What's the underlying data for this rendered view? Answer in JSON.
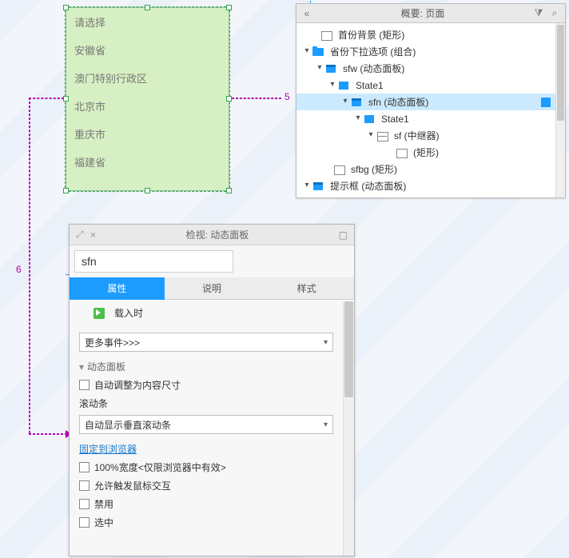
{
  "listbox": {
    "items": [
      "请选择",
      "安徽省",
      "澳门特别行政区",
      "北京市",
      "重庆市",
      "福建省"
    ]
  },
  "annotations": {
    "num5": "5",
    "num6": "6"
  },
  "outline": {
    "title": "概要: 页面",
    "filter_icon": "filter-icon",
    "search_icon": "search-icon",
    "nodes": [
      {
        "depth": 1,
        "tw": "",
        "ico": "rect-ico",
        "label": "首份背景 (矩形)"
      },
      {
        "depth": 1,
        "tw": "▾",
        "ico": "folder",
        "label": "省份下拉选项 (组合)"
      },
      {
        "depth": 2,
        "tw": "▾",
        "ico": "panel-ico",
        "label": "sfw (动态面板)"
      },
      {
        "depth": 3,
        "tw": "▾",
        "ico": "state-ico",
        "label": "State1"
      },
      {
        "depth": 4,
        "tw": "▾",
        "ico": "panel-ico",
        "label": "sfn (动态面板)",
        "selected": true,
        "slot": true
      },
      {
        "depth": 5,
        "tw": "▾",
        "ico": "state-ico",
        "label": "State1"
      },
      {
        "depth": 6,
        "tw": "▾",
        "ico": "grid-ico",
        "label": "sf (中继器)"
      },
      {
        "depth": 7,
        "tw": "",
        "ico": "rect-ico",
        "label": "(矩形)",
        "rect_glyph": true
      },
      {
        "depth": 2,
        "tw": "",
        "ico": "rect-ico",
        "label": "sfbg (矩形)"
      },
      {
        "depth": 1,
        "tw": "▾",
        "ico": "panel-ico",
        "label": "提示框 (动态面板)"
      }
    ]
  },
  "inspector": {
    "title": "检视: 动态面板",
    "name": "sfn",
    "tabs": {
      "props": "属性",
      "notes": "说明",
      "style": "样式"
    },
    "event_loaded": "载入时",
    "more_events": "更多事件>>>",
    "section_dp": "动态面板",
    "fit_content": "自动调整为内容尺寸",
    "scroll_label": "滚动条",
    "scroll_value": "自动显示垂直滚动条",
    "pin_link": "固定到浏览器",
    "full_width": "100%宽度<仅限浏览器中有效>",
    "mouse_events": "允许触发鼠标交互",
    "disable": "禁用",
    "last": "选中"
  }
}
